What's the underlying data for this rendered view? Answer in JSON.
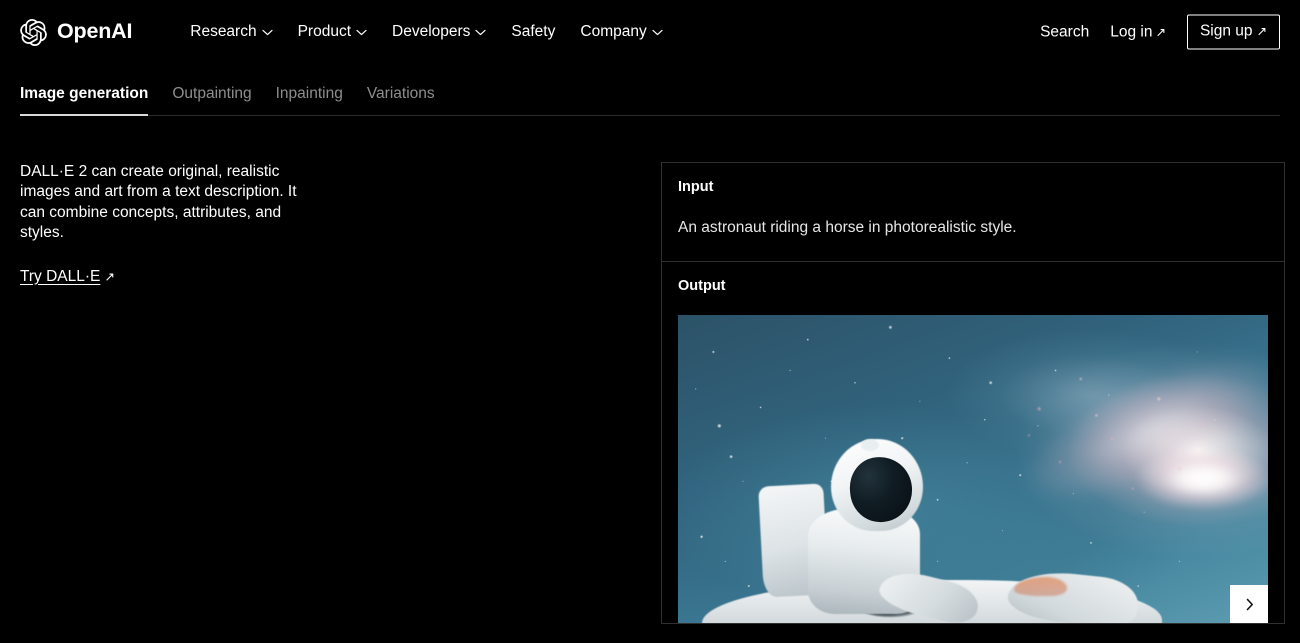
{
  "header": {
    "brand": {
      "name": "OpenAI",
      "logo_icon": "openai-logo-icon"
    },
    "nav": [
      {
        "label": "Research",
        "caret_icon": "chevron-down-icon"
      },
      {
        "label": "Product",
        "caret_icon": "chevron-down-icon"
      },
      {
        "label": "Developers",
        "caret_icon": "chevron-down-icon"
      },
      {
        "label": "Safety",
        "caret_icon": ""
      },
      {
        "label": "Company",
        "caret_icon": "chevron-down-icon"
      }
    ],
    "search_label": "Search",
    "login_label": "Log in",
    "login_arrow": "↗",
    "signup_label": "Sign up",
    "signup_arrow": "↗"
  },
  "tabs": [
    {
      "label": "Image generation",
      "active": true
    },
    {
      "label": "Outpainting",
      "active": false
    },
    {
      "label": "Inpainting",
      "active": false
    },
    {
      "label": "Variations",
      "active": false
    }
  ],
  "left": {
    "description": "DALL·E 2 can create original, realistic images and art from a text description. It can combine concepts, attributes, and styles.",
    "cta_label": "Try DALL·E",
    "cta_arrow": "↗"
  },
  "demo": {
    "input_label": "Input",
    "input_value": "An astronaut riding a horse in photorealistic style.",
    "output_label": "Output",
    "output_image_alt": "An astronaut in a white spacesuit riding a white horse against a teal starfield with a bright pink-and-white galaxy",
    "next_icon": "chevron-right-icon"
  },
  "colors": {
    "background": "#000000",
    "text": "#ffffff",
    "muted_text": "#8e8e8e",
    "border": "#303030",
    "accent_button": "#ffffff",
    "image_sky": "#3a7691",
    "image_galaxy": "#fff1f2"
  }
}
